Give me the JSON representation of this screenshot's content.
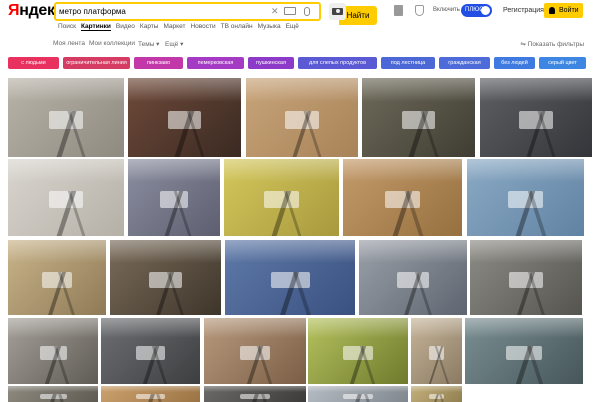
{
  "header": {
    "logo": "Яндекс",
    "search_value": "метро платформа",
    "find_button": "Найти",
    "plus_label": "Включить",
    "plus_badge": "ПЛЮС",
    "register": "Регистрация",
    "login": "Войти"
  },
  "services": [
    "Поиск",
    "Картинки",
    "Видео",
    "Карты",
    "Маркет",
    "Новости",
    "ТВ онлайн",
    "Музыка",
    "Ещё"
  ],
  "services_active": "Картинки",
  "filters": {
    "my_tape": "Моя лента",
    "my_collections": "Мои коллекции",
    "themes": "Темы ▾",
    "more": "Ещё ▾",
    "show_filters": "⇋ Показать фильтры"
  },
  "chips": [
    {
      "label": "с людьми",
      "color": "#e8315e"
    },
    {
      "label": "ограничительная линия",
      "color": "#d63c63"
    },
    {
      "label": "пинкзаво",
      "color": "#c238a8"
    },
    {
      "label": "пемерковская",
      "color": "#a53bc5"
    },
    {
      "label": "пушкинская",
      "color": "#8e3ac9"
    },
    {
      "label": "для слепых продуктов",
      "color": "#5b59d4"
    },
    {
      "label": "под лестница",
      "color": "#4c67d6"
    },
    {
      "label": "гражданская",
      "color": "#4d6cd9"
    },
    {
      "label": "без людей",
      "color": "#3f7ae0"
    },
    {
      "label": "серый цвет",
      "color": "#3d86e2"
    }
  ],
  "tiles": [
    {
      "name": "metro-platform-image",
      "bg": "#b8b3a8",
      "accent": "#8f8a80"
    },
    {
      "name": "metro-platform-image",
      "bg": "#6f4a3a",
      "accent": "#3a2a22"
    },
    {
      "name": "metro-platform-image",
      "bg": "#c8a47a",
      "accent": "#a88358"
    },
    {
      "name": "metro-platform-image",
      "bg": "#6e6a5a",
      "accent": "#3f3d33"
    },
    {
      "name": "metro-platform-image",
      "bg": "#5e5f63",
      "accent": "#34353a"
    },
    {
      "name": "metro-platform-image",
      "bg": "#d9d5cf",
      "accent": "#b5b0a6"
    },
    {
      "name": "metro-platform-image",
      "bg": "#8b8ea0",
      "accent": "#5d5f70"
    },
    {
      "name": "metro-platform-image",
      "bg": "#d4c75c",
      "accent": "#a89a3d"
    },
    {
      "name": "metro-platform-image",
      "bg": "#c49a6a",
      "accent": "#96703f"
    },
    {
      "name": "metro-platform-image",
      "bg": "#8aa9c4",
      "accent": "#6183a3"
    },
    {
      "name": "metro-platform-image",
      "bg": "#c9b48a",
      "accent": "#8e7a56"
    },
    {
      "name": "metro-platform-image",
      "bg": "#7a6c5a",
      "accent": "#3e352a"
    },
    {
      "name": "metro-platform-image",
      "bg": "#5e79a8",
      "accent": "#3a5180"
    },
    {
      "name": "metro-platform-image",
      "bg": "#9aa0a8",
      "accent": "#5f6570"
    },
    {
      "name": "metro-platform-image",
      "bg": "#8d8c86",
      "accent": "#55544f"
    },
    {
      "name": "metro-platform-image",
      "bg": "#a6a19a",
      "accent": "#5f5b55"
    },
    {
      "name": "metro-platform-image",
      "bg": "#6d6f72",
      "accent": "#3d3e40"
    },
    {
      "name": "metro-platform-image",
      "bg": "#b89a7e",
      "accent": "#7a5e45"
    },
    {
      "name": "metro-platform-image",
      "bg": "#b5c25e",
      "accent": "#6f7a2d"
    },
    {
      "name": "metro-platform-image",
      "bg": "#c6b59a",
      "accent": "#8a7a62"
    },
    {
      "name": "metro-platform-image",
      "bg": "#7b8f93",
      "accent": "#465659"
    },
    {
      "name": "metro-platform-image",
      "bg": "#8e8a80",
      "accent": "#5d5950"
    },
    {
      "name": "metro-platform-image",
      "bg": "#caa06d",
      "accent": "#9a7243"
    },
    {
      "name": "metro-platform-image",
      "bg": "#6c6a68",
      "accent": "#3c3a38"
    },
    {
      "name": "metro-platform-image",
      "bg": "#b5bcc3",
      "accent": "#7e858c"
    },
    {
      "name": "metro-platform-image",
      "bg": "#c3b07c",
      "accent": "#8e7c4d"
    }
  ]
}
